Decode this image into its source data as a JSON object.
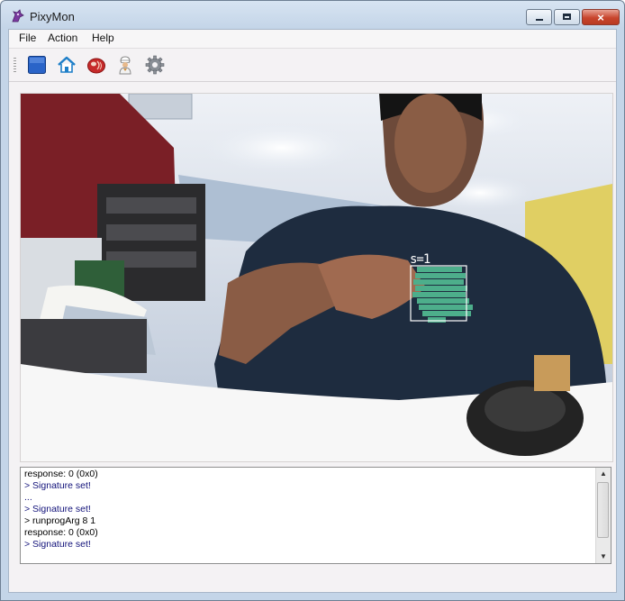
{
  "window": {
    "title": "PixyMon",
    "accent": "#c4d5e8",
    "controls": {
      "minimize": "minimize-icon",
      "maximize": "maximize-icon",
      "close": "×"
    }
  },
  "menu": {
    "items": [
      "File",
      "Action",
      "Help"
    ]
  },
  "toolbar": {
    "buttons": [
      {
        "icon": "raw-video-icon"
      },
      {
        "icon": "home-icon"
      },
      {
        "icon": "meat-icon"
      },
      {
        "icon": "chef-icon"
      },
      {
        "icon": "gear-icon"
      }
    ]
  },
  "video": {
    "detected_block": {
      "label": "s=1",
      "color": "#4dae8b"
    }
  },
  "console": {
    "lines": [
      {
        "text": "response: 0 (0x0)",
        "kind": "cmd"
      },
      {
        "text": "> Signature set!",
        "kind": "reply"
      },
      {
        "text": "...",
        "kind": "reply"
      },
      {
        "text": "> Signature set!",
        "kind": "reply"
      },
      {
        "text": "> runprogArg 8 1",
        "kind": "cmd"
      },
      {
        "text": "response: 0 (0x0)",
        "kind": "cmd"
      },
      {
        "text": "> Signature set!",
        "kind": "reply"
      }
    ],
    "scroll_up": "▲",
    "scroll_down": "▼"
  }
}
